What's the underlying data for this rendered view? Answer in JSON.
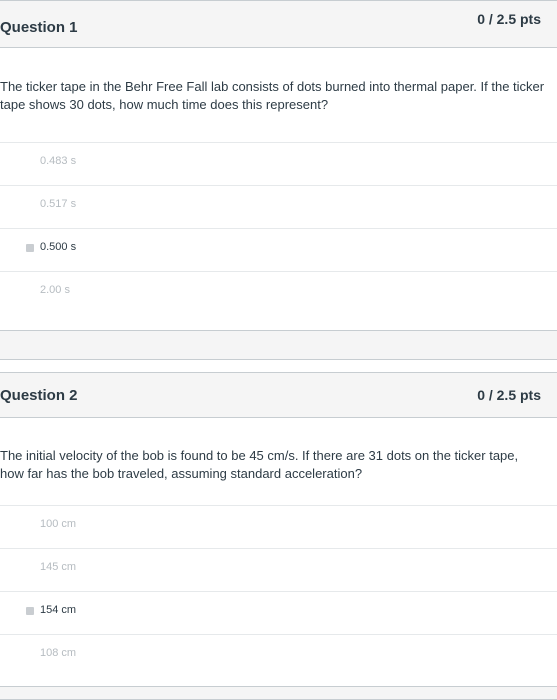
{
  "questions": [
    {
      "title": "Question 1",
      "points": "0 / 2.5 pts",
      "text": "The ticker tape in the Behr Free Fall lab consists of dots burned into thermal paper. If the ticker tape shows 30 dots, how much time does this represent?",
      "answers": [
        {
          "label": "0.483 s",
          "selected": false
        },
        {
          "label": "0.517 s",
          "selected": false
        },
        {
          "label": "0.500 s",
          "selected": true
        },
        {
          "label": "2.00 s",
          "selected": false
        }
      ]
    },
    {
      "title": "Question 2",
      "points": "0 / 2.5 pts",
      "text": "The initial velocity of the bob is found to be 45 cm/s. If there are 31 dots on the ticker tape, how far has the bob traveled, assuming standard acceleration?",
      "answers": [
        {
          "label": "100 cm",
          "selected": false
        },
        {
          "label": "145 cm",
          "selected": false
        },
        {
          "label": "154 cm",
          "selected": true
        },
        {
          "label": "108 cm",
          "selected": false
        }
      ]
    }
  ]
}
